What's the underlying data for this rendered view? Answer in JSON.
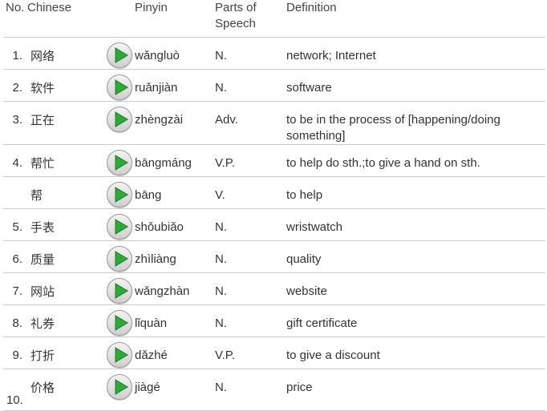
{
  "headers": {
    "no": "No.",
    "chinese": "Chinese",
    "pinyin": "Pinyin",
    "pos_line1": "Parts of",
    "pos_line2": "Speech",
    "definition": "Definition"
  },
  "rows": [
    {
      "no": "1.",
      "chinese": "网络",
      "pinyin": "wǎngluò",
      "pos": "N.",
      "def": "network; Internet"
    },
    {
      "no": "2.",
      "chinese": "软件",
      "pinyin": "ruǎnjiàn",
      "pos": "N.",
      "def": "software"
    },
    {
      "no": "3.",
      "chinese": "正在",
      "pinyin": "zhèngzài",
      "pos": "Adv.",
      "def": "to be in the process of [happening/doing something]"
    },
    {
      "no": "4.",
      "chinese": "帮忙",
      "pinyin": "bāngmáng",
      "pos": "V.P.",
      "def": "to help do sth.;to give a hand on sth."
    },
    {
      "no": "",
      "chinese": "帮",
      "pinyin": "bāng",
      "pos": "V.",
      "def": "to help"
    },
    {
      "no": "5.",
      "chinese": "手表",
      "pinyin": "shǒubiǎo",
      "pos": "N.",
      "def": "wristwatch"
    },
    {
      "no": "6.",
      "chinese": "质量",
      "pinyin": "zhìliàng",
      "pos": "N.",
      "def": "quality"
    },
    {
      "no": "7.",
      "chinese": "网站",
      "pinyin": "wǎngzhàn",
      "pos": "N.",
      "def": "website"
    },
    {
      "no": "8.",
      "chinese": "礼券",
      "pinyin": "lǐquàn",
      "pos": "N.",
      "def": "gift certificate"
    },
    {
      "no": "9.",
      "chinese": "打折",
      "pinyin": "dǎzhé",
      "pos": "V.P.",
      "def": "to give a discount"
    },
    {
      "no": "10.",
      "chinese": "价格",
      "pinyin": "jiàgé",
      "pos": "N.",
      "def": "price"
    }
  ],
  "play_icon": "play-audio-icon",
  "colors": {
    "play_green": "#2fa83a",
    "border": "#cccccc"
  }
}
